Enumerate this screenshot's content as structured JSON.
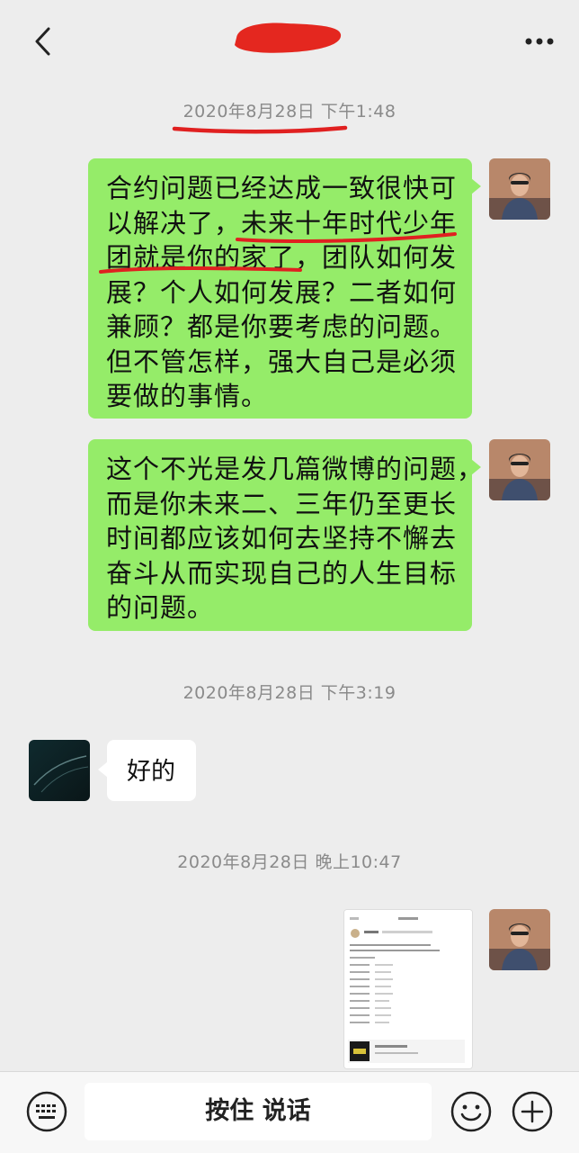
{
  "header": {
    "back_icon": "chevron-left-icon",
    "more_icon": "more-dots-icon"
  },
  "timestamps": [
    "2020年8月28日 下午1:48",
    "2020年8月28日 下午3:19",
    "2020年8月28日 晚上10:47"
  ],
  "messages": [
    {
      "side": "right",
      "lines": [
        "合约问题已经达成一致很快可",
        "以解决了，未来十年时代少年",
        "团就是你的家了，团队如何发",
        "展？个人如何发展？二者如何",
        "兼顾？都是你要考虑的问题。",
        "但不管怎样，强大自己是必须",
        "要做的事情。"
      ]
    },
    {
      "side": "right",
      "lines": [
        "这个不光是发几篇微博的问题，",
        "而是你未来二、三年仍至更长",
        "时间都应该如何去坚持不懈去",
        "奋斗从而实现自己的人生目标",
        "的问题。"
      ]
    },
    {
      "side": "left",
      "text": "好的"
    }
  ],
  "input_bar": {
    "voice_keyboard_icon": "keyboard-icon",
    "hold_to_talk": "按住 说话",
    "emoji_icon": "emoji-icon",
    "plus_icon": "plus-icon"
  },
  "colors": {
    "chat_bg": "#ededed",
    "bubble_green": "#95ec69",
    "bubble_white": "#ffffff",
    "annotation_red": "#e02020"
  }
}
